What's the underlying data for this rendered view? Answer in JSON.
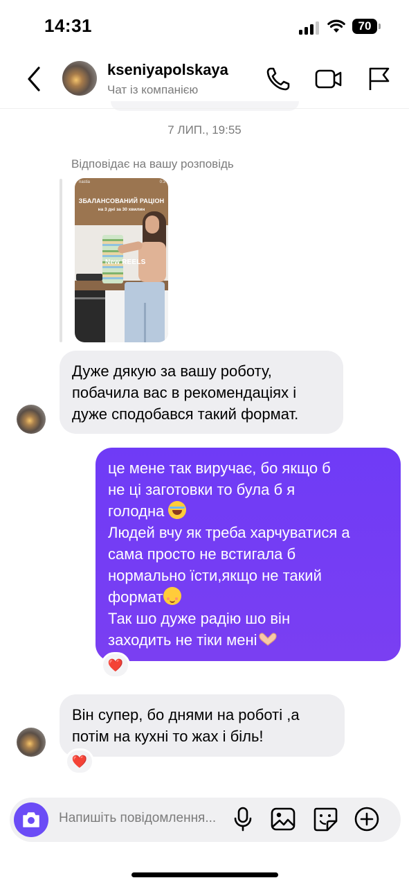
{
  "status_bar": {
    "time": "14:31",
    "battery": "70"
  },
  "header": {
    "username": "kseniyapolskaya",
    "subtitle": "Чат із компанією",
    "icons": [
      "back-chevron-icon",
      "phone-icon",
      "video-camera-icon",
      "flag-icon"
    ]
  },
  "thread": {
    "timestamp": "7 ЛИП., 19:55",
    "reply_label": "Відповідає на вашу розповідь",
    "story": {
      "title_line1": "ЗБАЛАНСОВАНИЙ РАЦІОН",
      "title_line2": "на 3 дні за 30 хвилин",
      "badge": "New REELS",
      "user": "nastia",
      "time": "0:3"
    },
    "messages": [
      {
        "from": "kseniyapolskaya",
        "lines": [
          "Дуже дякую за вашу роботу,",
          "побачила вас в рекомендаціях і",
          "дуже сподобався такий формат."
        ]
      },
      {
        "from": "me",
        "lines": [
          "це мене так виручає, бо якщо б",
          "не ці заготовки то була б я",
          "голодна",
          "Людей вчу як треба харчуватися а",
          "сама просто не встигала б",
          "нормально їсти,якщо не такий",
          "формат",
          "Так шо дуже радію шо він",
          "заходить не тіки мені"
        ],
        "reaction": "❤️"
      },
      {
        "from": "kseniyapolskaya",
        "lines": [
          "Він супер, бо днями на роботі ,а",
          "потім на кухні то жах і біль!"
        ],
        "reaction": "❤️"
      }
    ]
  },
  "composer": {
    "placeholder": "Напишіть повідомлення...",
    "icons": [
      "camera-icon",
      "microphone-icon",
      "gallery-icon",
      "sticker-icon",
      "plus-icon"
    ]
  },
  "colors": {
    "outgoing_bubble": "#7a3ff2",
    "incoming_bubble": "#eeeef1",
    "camera_button": "#6b4cf6"
  }
}
